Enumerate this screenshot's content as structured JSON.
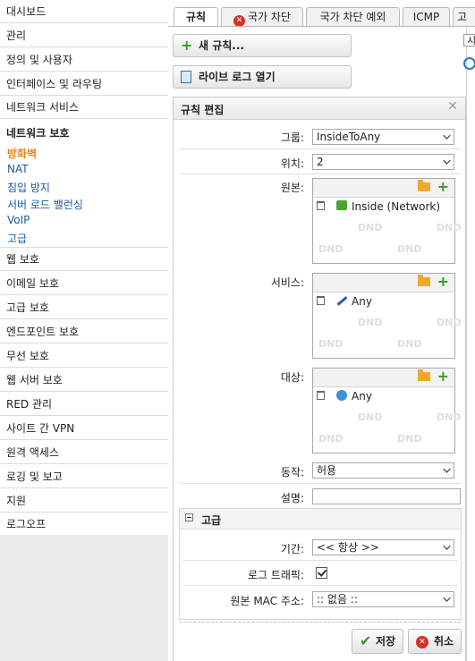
{
  "sidebar": {
    "items_top": [
      "대시보드",
      "관리",
      "정의 및 사용자",
      "인터페이스 및 라우팅",
      "네트워크 서비스"
    ],
    "section_title": "네트워크 보호",
    "sub_items": [
      "방화벽",
      "NAT",
      "침입 방지",
      "서버 로드 밸런싱",
      "VoIP",
      "고급"
    ],
    "items_bottom": [
      "웹 보호",
      "이메일 보호",
      "고급 보호",
      "엔드포인트 보호",
      "무선 보호",
      "웹 서버 보호",
      "RED 관리",
      "사이트 간 VPN",
      "원격 액세스",
      "로깅 및 보고",
      "지원",
      "로그오프"
    ]
  },
  "tabs": [
    "규칙",
    "국가 차단",
    "국가 차단 예외",
    "ICMP",
    "고"
  ],
  "buttons": {
    "new_rule": "새 규칙...",
    "open_live_log": "라이브 로그 열기"
  },
  "right_col": {
    "frag": "시"
  },
  "panel": {
    "title": "규칙 편집",
    "group_label": "그룹:",
    "group_value": "InsideToAny",
    "position_label": "위치:",
    "position_value": "2",
    "source_label": "원본:",
    "source_entry": "Inside (Network)",
    "service_label": "서비스:",
    "service_entry": "Any",
    "dest_label": "대상:",
    "dest_entry": "Any",
    "action_label": "동작:",
    "action_value": "허용",
    "desc_label": "설명:",
    "desc_value": "",
    "dnd": "DND",
    "advanced": {
      "title": "고급",
      "time_label": "기간:",
      "time_value": "<< 항상 >>",
      "log_label": "로그 트래픽:",
      "log_checked": true,
      "mac_label": "원본 MAC 주소:",
      "mac_value": ":: 없음 ::"
    },
    "save": "저장",
    "cancel": "취소"
  }
}
